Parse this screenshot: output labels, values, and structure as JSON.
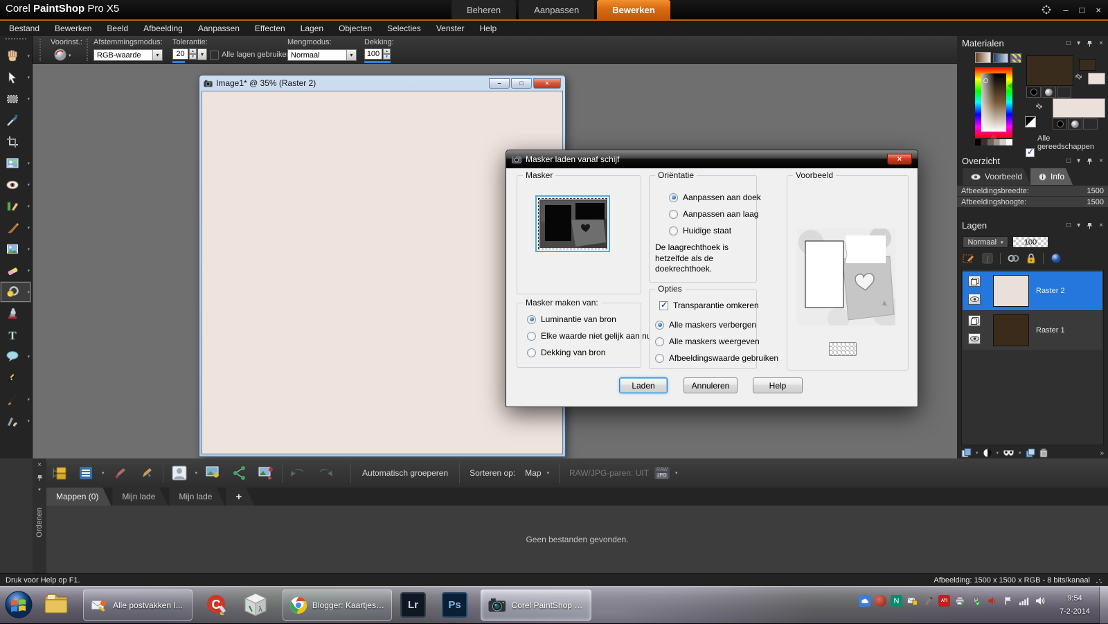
{
  "glyphs": {
    "minimize": "–",
    "maximize": "□",
    "close": "×",
    "dropdown": "▾",
    "chevrons": "»",
    "swap": "⇄",
    "text_tool": "T",
    "lambda": "λ",
    "ccleaner": "C"
  },
  "titlebar": {
    "brand_corel": "Corel",
    "brand_paintshop": "PaintShop",
    "brand_pro": "Pro X5",
    "tabs": [
      {
        "label": "Beheren"
      },
      {
        "label": "Aanpassen"
      },
      {
        "label": "Bewerken"
      }
    ]
  },
  "menubar": {
    "items": [
      "Bestand",
      "Bewerken",
      "Beeld",
      "Afbeelding",
      "Aanpassen",
      "Effecten",
      "Lagen",
      "Objecten",
      "Selecties",
      "Venster",
      "Help"
    ]
  },
  "options_toolbar": {
    "preset_label": "Voorinst.:",
    "match_mode_label": "Afstemmingsmodus:",
    "match_mode_value": "RGB-waarde",
    "tolerance_label": "Tolerantie:",
    "tolerance_value": "20",
    "all_layers_label": "Alle lagen gebruiken",
    "blend_label": "Mengmodus:",
    "blend_value": "Normaal",
    "opacity_label": "Dekking:",
    "opacity_value": "100"
  },
  "image_window": {
    "title": "Image1* @  35% (Raster 2)"
  },
  "dialog": {
    "title": "Masker laden vanaf schijf",
    "mask_group_label": "Masker",
    "orientation_group_label": "Oriëntatie",
    "orientation_options": [
      "Aanpassen aan doek",
      "Aanpassen aan laag",
      "Huidige staat"
    ],
    "orientation_note": "De laagrechthoek is hetzelfde als de doekrechthoek.",
    "create_group_label": "Masker maken van:",
    "create_options": [
      "Luminantie van bron",
      "Elke waarde niet gelijk aan nul",
      "Dekking van bron"
    ],
    "options_group_label": "Opties",
    "invert_transparency_label": "Transparantie omkeren",
    "mask_visibility_options": [
      "Alle maskers verbergen",
      "Alle maskers weergeven",
      "Afbeeldingswaarde gebruiken"
    ],
    "preview_group_label": "Voorbeeld",
    "load_button": "Laden",
    "cancel_button": "Annuleren",
    "help_button": "Help"
  },
  "materials_panel": {
    "title": "Materialen",
    "all_tools_label": "Alle gereedschappen"
  },
  "overview_panel": {
    "title": "Overzicht",
    "preview_tab": "Voorbeeld",
    "info_tab": "Info",
    "info_rows": [
      {
        "label": "Afbeeldingsbreedte:",
        "value": "1500"
      },
      {
        "label": "Afbeeldingshoogte:",
        "value": "1500"
      }
    ]
  },
  "layers_panel": {
    "title": "Lagen",
    "blend_value": "Normaal",
    "opacity_value": "100",
    "layers": [
      {
        "name": "Raster 2",
        "selected": true
      },
      {
        "name": "Raster 1",
        "selected": false
      }
    ]
  },
  "organizer": {
    "vertical_label": "Ordenen",
    "auto_group_label": "Automatisch groeperen",
    "sort_label": "Sorteren op:",
    "sort_value": "Map",
    "raw_pairs_label": "RAW/JPG-paren: UIT",
    "raw_badge_line1": "RAW",
    "raw_badge_line2": "JPG",
    "tabs": [
      {
        "label": "Mappen (0)"
      },
      {
        "label": "Mijn lade"
      },
      {
        "label": "Mijn lade"
      },
      {
        "label": "+"
      }
    ],
    "empty_message": "Geen bestanden gevonden."
  },
  "statusbar": {
    "help_text": "Druk voor Help op F1.",
    "image_info": "Afbeelding:  1500 x 1500 x RGB - 8 bits/kanaal"
  },
  "taskbar": {
    "buttons": [
      {
        "label": "Alle postvakken I..."
      },
      {
        "label": "Blogger: Kaartjes ..."
      },
      {
        "label": "Corel PaintShop P..."
      }
    ],
    "lr_label": "Lr",
    "ps_label": "Ps",
    "ati_label": "ATI",
    "n_label": "N",
    "clock_time": "9:54",
    "clock_date": "7-2-2014"
  }
}
